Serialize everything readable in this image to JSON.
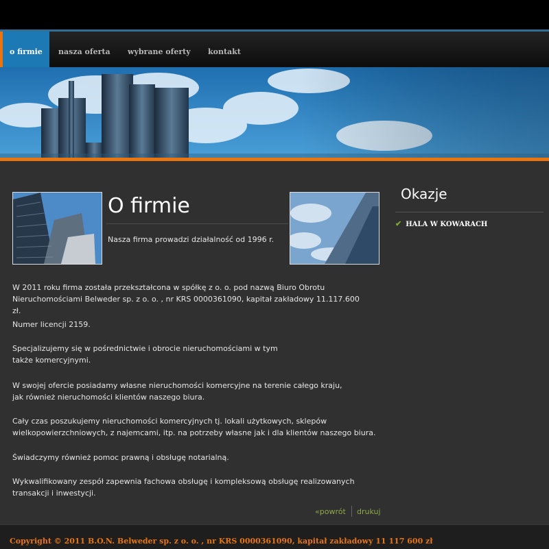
{
  "nav": {
    "items": [
      {
        "label": "o firmie",
        "active": true
      },
      {
        "label": "nasza oferta",
        "active": false
      },
      {
        "label": "wybrane oferty",
        "active": false
      },
      {
        "label": "kontakt",
        "active": false
      }
    ]
  },
  "main": {
    "title": "O firmie",
    "intro": "Nasza firma prowadzi działalność od 1996 r.",
    "paragraphs": [
      "W 2011 roku firma została przekształcona w spółkę z o. o. pod nazwą Biuro Obrotu Nieruchomościami Belweder sp. z o. o. , nr KRS 0000361090, kapitał zakładowy 11.117.600 zł.",
      "Numer licencji 2159.",
      "Specjalizujemy się w pośrednictwie i obrocie nieruchomościami w tym także komercyjnymi.",
      "W swojej ofercie posiadamy własne nieruchomości komercyjne na terenie całego kraju, jak również nieruchomości klientów naszego biura.",
      "Cały czas poszukujemy nieruchomości komercyjnych tj. lokali użytkowych, sklepów wielkopowierzchniowych, z najemcami, itp. na potrzeby własne jak i dla klientów naszego biura.",
      "Świadczymy również pomoc prawną i obsługę notarialną.",
      "Wykwalifikowany zespół zapewnia fachowa obsługę i kompleksową obsługę realizowanych transakcji i inwestycji."
    ],
    "back_link": "«powrót",
    "print_link": "drukuj"
  },
  "sidebar": {
    "title": "Okazje",
    "items": [
      {
        "label": "HALA W KOWARACH"
      }
    ]
  },
  "footer": {
    "copyright": "Copyright © 2011 B.O.N. Belweder sp. z o. o. , nr KRS 0000361090, kapitał zakładowy 11 117 600 zł"
  },
  "colors": {
    "accent_orange": "#e8750f",
    "nav_active_blue": "#1c79b4",
    "link_green": "#8fa84a",
    "background": "#303030"
  }
}
